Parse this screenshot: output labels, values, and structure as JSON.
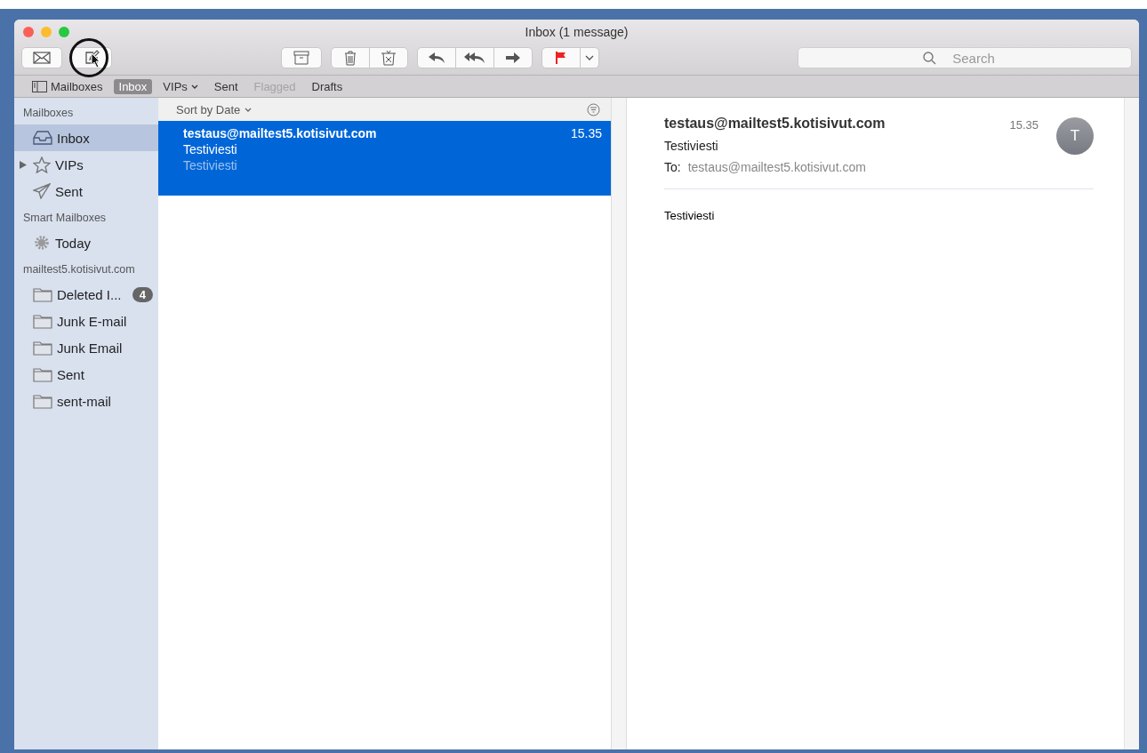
{
  "window": {
    "title": "Inbox (1 message)"
  },
  "search": {
    "placeholder": "Search"
  },
  "favorites": [
    {
      "label": "Mailboxes",
      "kind": "toggle",
      "selected": false,
      "disabled": false
    },
    {
      "label": "Inbox",
      "kind": "item",
      "selected": true,
      "disabled": false
    },
    {
      "label": "VIPs",
      "kind": "menu",
      "selected": false,
      "disabled": false
    },
    {
      "label": "Sent",
      "kind": "item",
      "selected": false,
      "disabled": false
    },
    {
      "label": "Flagged",
      "kind": "item",
      "selected": false,
      "disabled": true
    },
    {
      "label": "Drafts",
      "kind": "item",
      "selected": false,
      "disabled": false
    }
  ],
  "sidebar": {
    "sections": [
      {
        "title": "Mailboxes",
        "items": [
          {
            "label": "Inbox",
            "kind": "inbox",
            "selected": true
          },
          {
            "label": "VIPs",
            "kind": "star",
            "selected": false,
            "expanded": false
          },
          {
            "label": "Sent",
            "kind": "sent",
            "selected": false
          }
        ]
      },
      {
        "title": "Smart Mailboxes",
        "items": [
          {
            "label": "Today",
            "kind": "gear",
            "selected": false
          }
        ]
      },
      {
        "title": "mailtest5.kotisivut.com",
        "items": [
          {
            "label": "Deleted I...",
            "kind": "folder",
            "selected": false,
            "badge": "4"
          },
          {
            "label": "Junk E-mail",
            "kind": "folder",
            "selected": false
          },
          {
            "label": "Junk Email",
            "kind": "folder",
            "selected": false
          },
          {
            "label": "Sent",
            "kind": "folder",
            "selected": false
          },
          {
            "label": "sent-mail",
            "kind": "folder",
            "selected": false
          }
        ]
      }
    ]
  },
  "message_list": {
    "sort": "Sort by Date",
    "messages": [
      {
        "sender": "testaus@mailtest5.kotisivut.com",
        "time": "15.35",
        "subject": "Testiviesti",
        "preview": "Testiviesti",
        "selected": true
      }
    ]
  },
  "message": {
    "sender": "testaus@mailtest5.kotisivut.com",
    "time": "15.35",
    "avatar": "T",
    "subject": "Testiviesti",
    "to_label": "To:",
    "to": "testaus@mailtest5.kotisivut.com",
    "body": "Testiviesti"
  }
}
